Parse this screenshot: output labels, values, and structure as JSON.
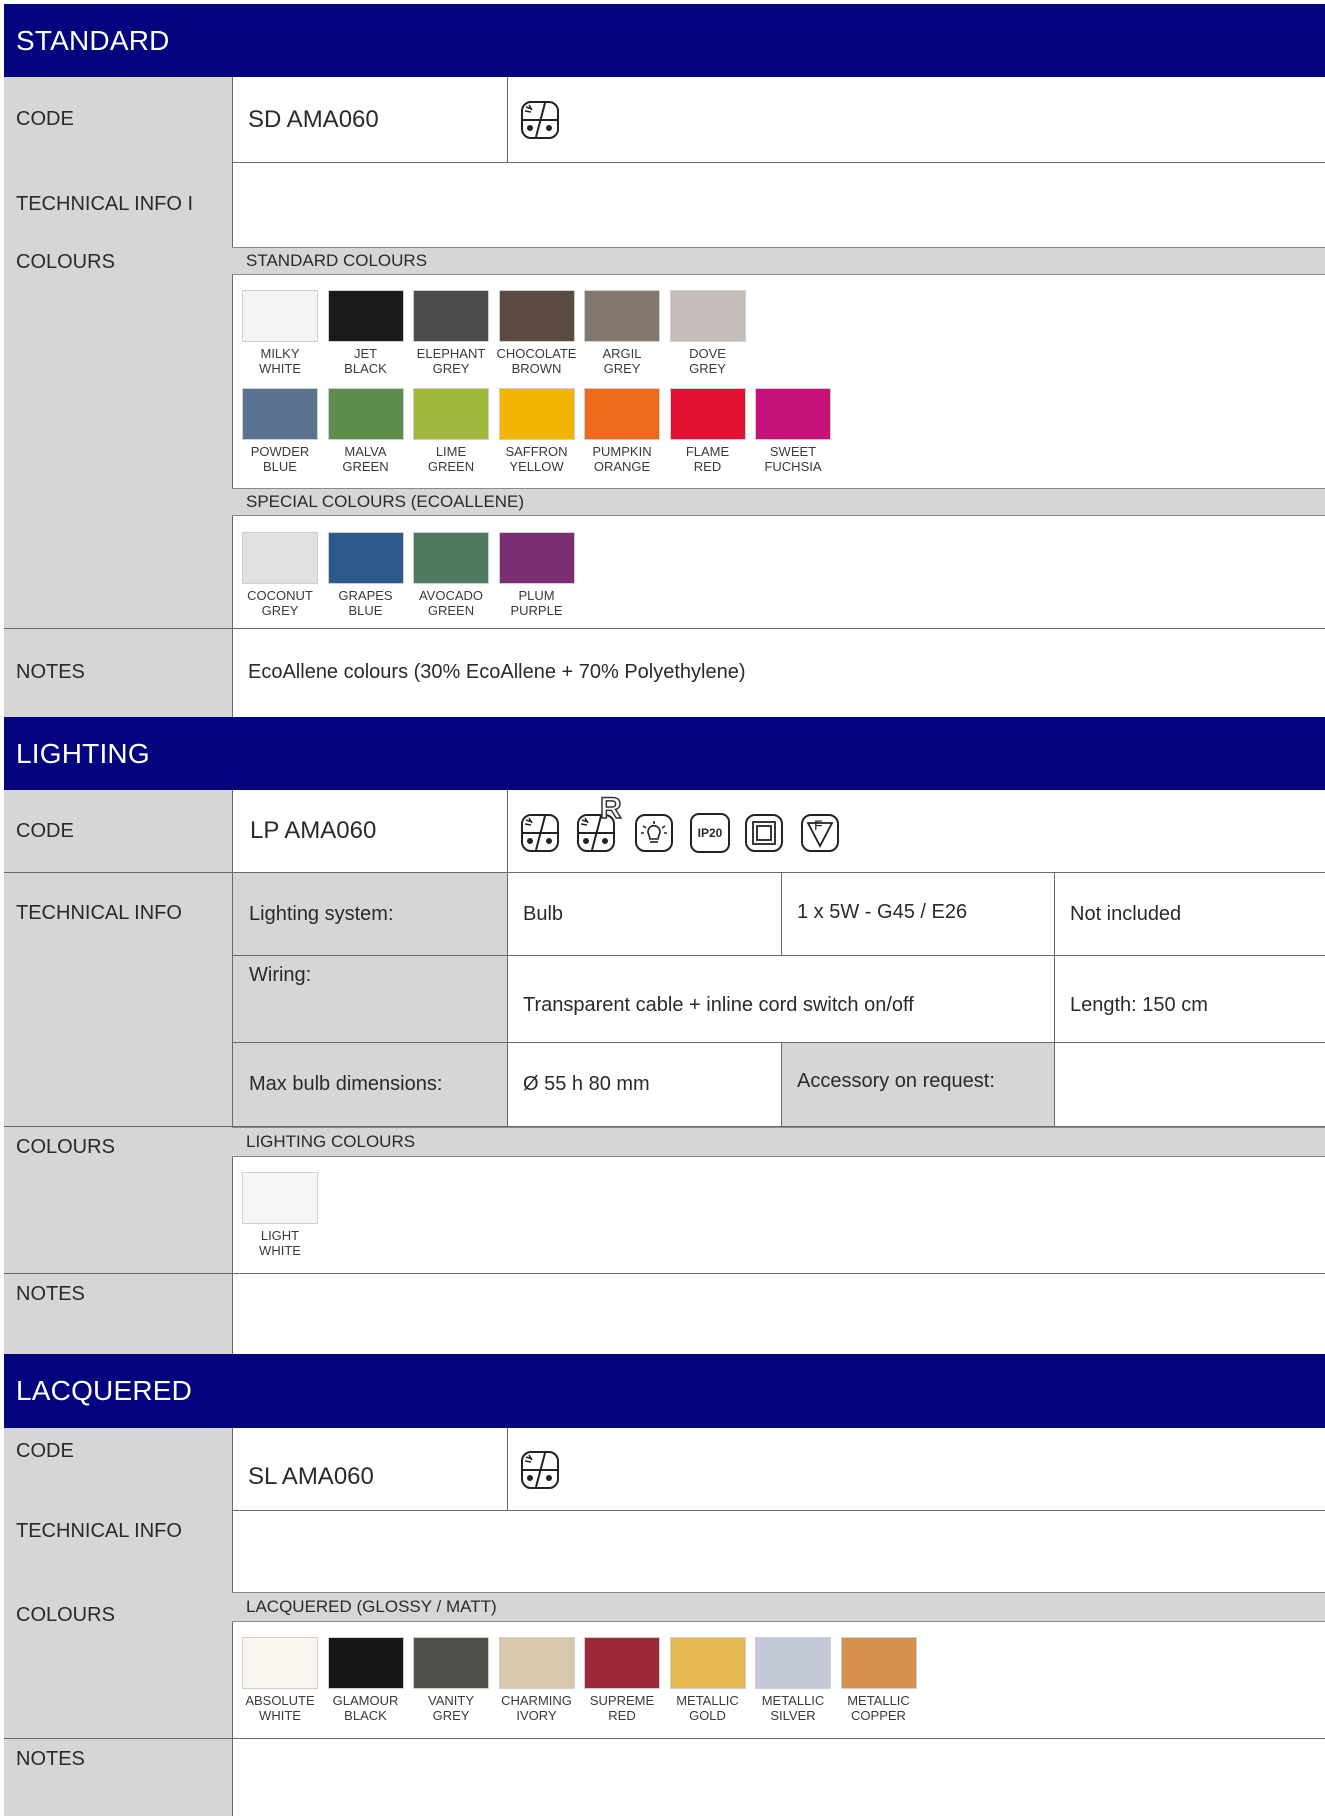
{
  "standard": {
    "title": "STANDARD",
    "code_label": "CODE",
    "code": "SD AMA060",
    "tech_label": "TECHNICAL INFO I",
    "colours_label": "COLOURS",
    "std_colours_header": "STANDARD COLOURS",
    "std_colours": [
      {
        "l1": "MILKY",
        "l2": "WHITE",
        "color": "#f6f5f3"
      },
      {
        "l1": "JET",
        "l2": "BLACK",
        "color": "#1c1a19"
      },
      {
        "l1": "ELEPHANT",
        "l2": "GREY",
        "color": "#4d4d4f"
      },
      {
        "l1": "CHOCOLATE",
        "l2": "BROWN",
        "color": "#5b4a42"
      },
      {
        "l1": "ARGIL",
        "l2": "GREY",
        "color": "#82786f"
      },
      {
        "l1": "DOVE",
        "l2": "GREY",
        "color": "#c3bcb8"
      },
      {
        "l1": "POWDER",
        "l2": "BLUE",
        "color": "#5a7390"
      },
      {
        "l1": "MALVA",
        "l2": "GREEN",
        "color": "#5f8d4e"
      },
      {
        "l1": "LIME",
        "l2": "GREEN",
        "color": "#9db83a"
      },
      {
        "l1": "SAFFRON",
        "l2": "YELLOW",
        "color": "#f2b400"
      },
      {
        "l1": "PUMPKIN",
        "l2": "ORANGE",
        "color": "#ec6a1a"
      },
      {
        "l1": "FLAME",
        "l2": "RED",
        "color": "#e21331"
      },
      {
        "l1": "SWEET",
        "l2": "FUCHSIA",
        "color": "#c4127a"
      }
    ],
    "special_header": "SPECIAL COLOURS (ECOALLENE)",
    "special_colours": [
      {
        "l1": "COCONUT",
        "l2": "GREY",
        "color": "#dfe0df"
      },
      {
        "l1": "GRAPES",
        "l2": "BLUE",
        "color": "#2d5a8a"
      },
      {
        "l1": "AVOCADO",
        "l2": "GREEN",
        "color": "#4f7a5f"
      },
      {
        "l1": "PLUM",
        "l2": "PURPLE",
        "color": "#7c2e73"
      }
    ],
    "notes_label": "NOTES",
    "notes": "EcoAllene colours (30% EcoAllene + 70% Polyethylene)"
  },
  "lighting": {
    "title": "LIGHTING",
    "code_label": "CODE",
    "code": "LP AMA060",
    "icon_ip": "IP20",
    "icon_r": "R",
    "icon_f": "F",
    "tech_label": "TECHNICAL INFO",
    "lighting_system_label": "Lighting system:",
    "lighting_system": "Bulb",
    "bulb_spec": "1 x 5W - G45 / E26",
    "bulb_included": "Not included",
    "wiring_label": "Wiring:",
    "wiring": "Transparent cable + inline cord switch on/off",
    "cable_length": "Length: 150 cm",
    "max_bulb_label": "Max bulb dimensions:",
    "max_bulb": "Ø 55 h 80 mm",
    "accessory_label": "Accessory on request:",
    "colours_label": "COLOURS",
    "colours_header": "LIGHTING COLOURS",
    "colours": [
      {
        "l1": "LIGHT",
        "l2": "WHITE",
        "color": "#f7f6f7"
      }
    ],
    "notes_label": "NOTES"
  },
  "lacquered": {
    "title": "LACQUERED",
    "code_label": "CODE",
    "code": "SL AMA060",
    "tech_label": "TECHNICAL INFO",
    "colours_label": "COLOURS",
    "colours_header": "LACQUERED (GLOSSY / MATT)",
    "colours": [
      {
        "l1": "ABSOLUTE",
        "l2": "WHITE",
        "color": "#f8f6ee"
      },
      {
        "l1": "GLAMOUR",
        "l2": "BLACK",
        "color": "#191716"
      },
      {
        "l1": "VANITY",
        "l2": "GREY",
        "color": "#4f4e48"
      },
      {
        "l1": "CHARMING",
        "l2": "IVORY",
        "color": "#d8c8ae"
      },
      {
        "l1": "SUPREME",
        "l2": "RED",
        "color": "#9b2a36"
      },
      {
        "l1": "METALLIC",
        "l2": "GOLD",
        "color": "#e6b850"
      },
      {
        "l1": "METALLIC",
        "l2": "SILVER",
        "color": "#c3c8d6"
      },
      {
        "l1": "METALLIC",
        "l2": "COPPER",
        "color": "#d6904d"
      }
    ],
    "notes_label": "NOTES"
  }
}
